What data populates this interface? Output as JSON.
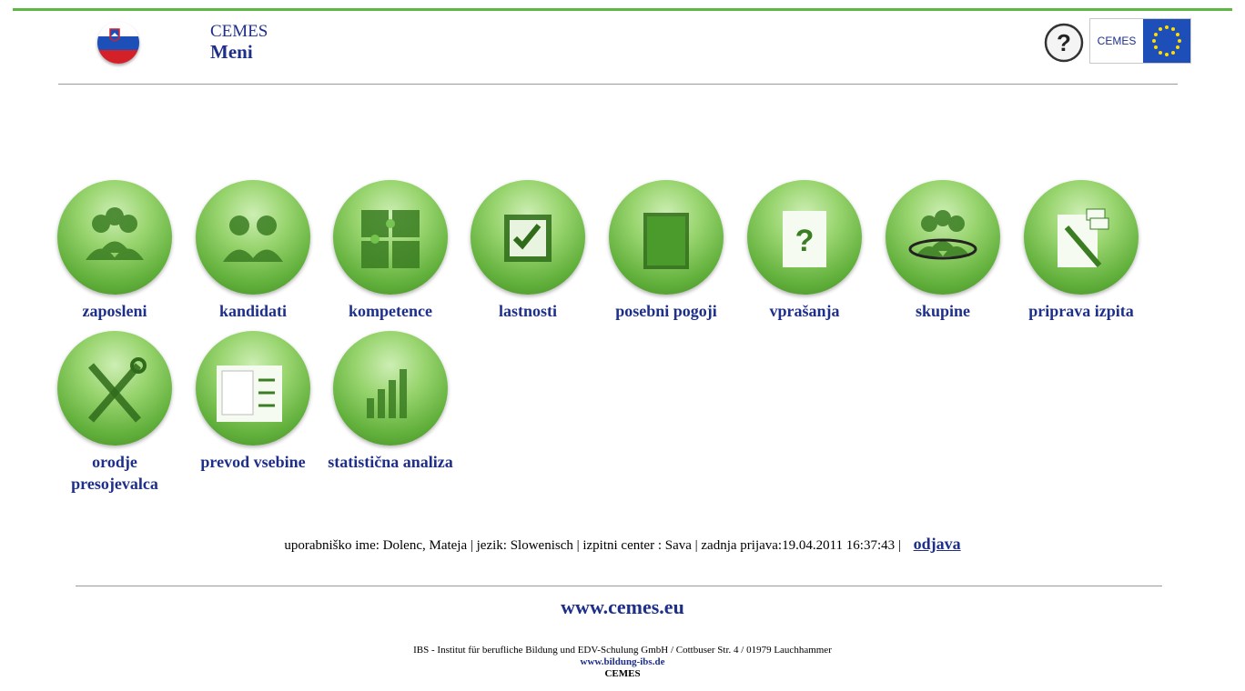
{
  "colors": {
    "accent_green": "#5cb843",
    "link_blue": "#1e2f8a",
    "ball_green": "#63b13d"
  },
  "header": {
    "title_top": "CEMES",
    "title_main": "Meni",
    "flag_icon": "slovenia-flag-icon",
    "help_icon": "question-mark-icon",
    "logo_text": "CEMES"
  },
  "menu": [
    {
      "label": "zaposleni",
      "icon": "employees-icon"
    },
    {
      "label": "kandidati",
      "icon": "candidates-icon"
    },
    {
      "label": "kompetence",
      "icon": "puzzle-icon"
    },
    {
      "label": "lastnosti",
      "icon": "checkbox-icon"
    },
    {
      "label": "posebni pogoji",
      "icon": "book-icon"
    },
    {
      "label": "vprašanja",
      "icon": "question-document-icon"
    },
    {
      "label": "skupine",
      "icon": "group-icon"
    },
    {
      "label": "priprava izpita",
      "icon": "exam-preparation-icon"
    },
    {
      "label": "orodje presojevalca",
      "icon": "tools-icon"
    },
    {
      "label": "prevod vsebine",
      "icon": "translation-icon"
    },
    {
      "label": "statistična analiza",
      "icon": "statistics-icon"
    }
  ],
  "status": {
    "text": "uporabniško ime:  Dolenc, Mateja  | jezik: Slowenisch  | izpitni center : Sava   | zadnja prijava:19.04.2011 16:37:43  |",
    "logout": "odjava"
  },
  "site_link": "www.cemes.eu",
  "footer": {
    "address": "IBS - Institut für berufliche Bildung und EDV-Schulung GmbH / Cottbuser Str. 4 / 01979 Lauchhammer",
    "link": "www.bildung-ibs.de",
    "brand": "CEMES"
  }
}
